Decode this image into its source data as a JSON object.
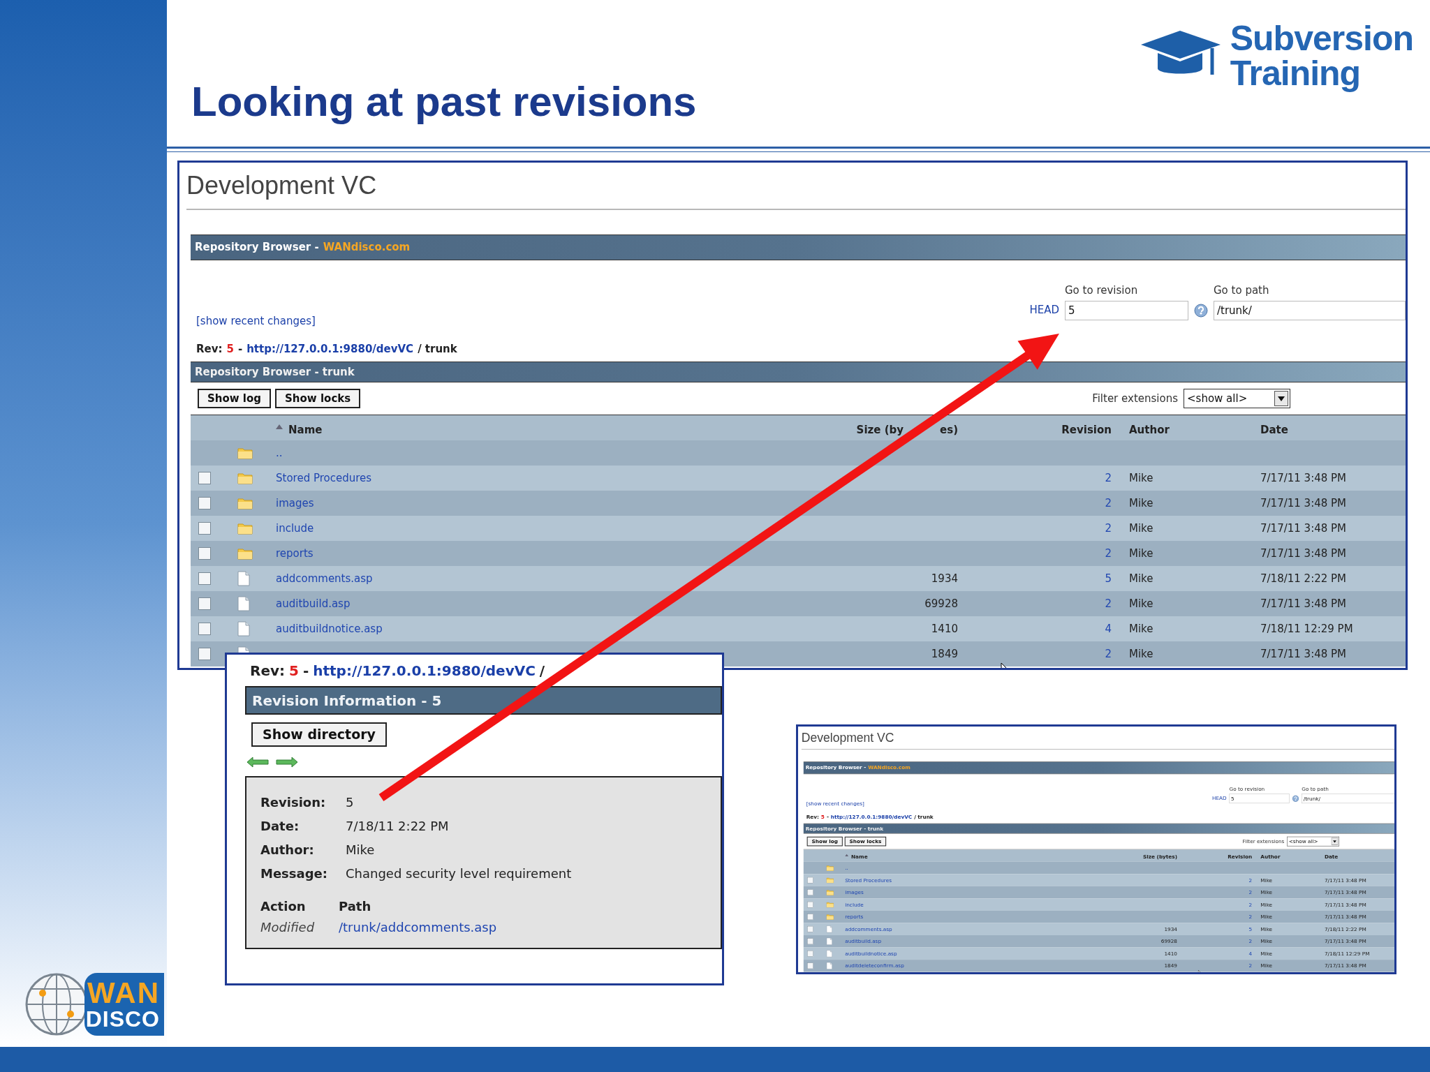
{
  "slide": {
    "title": "Looking at past revisions",
    "brand_logo": [
      "Subversion",
      "Training"
    ],
    "footer_logo": [
      "WAN",
      "DISCO"
    ]
  },
  "main_screenshot": {
    "page_title": "Development VC",
    "header_bar": {
      "label": "Repository Browser -",
      "link": "WANdisco.com"
    },
    "revision_label": "Go to revision",
    "path_label": "Go to path",
    "head_link": "HEAD",
    "revision_field": "5",
    "path_field": "/trunk/",
    "recent_changes_link": "[show recent changes]",
    "rev_line": {
      "prefix": "Rev:",
      "revision": "5",
      "dash": "-",
      "url": "http://127.0.0.1:9880/devVC",
      "path": "/ trunk"
    },
    "section_bar": "Repository Browser - trunk",
    "buttons": [
      "Show log",
      "Show locks"
    ],
    "filter_label": "Filter extensions",
    "filter_value": "<show all>",
    "columns": [
      {
        "label": "Name",
        "sorted": true
      },
      {
        "label": "Size (by",
        "label_after": "es)",
        "sorted": false
      },
      {
        "label": "Revision",
        "sorted": false
      },
      {
        "label": "Author",
        "sorted": false
      },
      {
        "label": "Date",
        "sorted": false
      }
    ],
    "rows": [
      {
        "kind": "parent",
        "name": ".."
      },
      {
        "kind": "folder",
        "name": "Stored Procedures",
        "revision": "2",
        "author": "Mike",
        "date": "7/17/11 3:48 PM",
        "checked": false
      },
      {
        "kind": "folder",
        "name": "images",
        "revision": "2",
        "author": "Mike",
        "date": "7/17/11 3:48 PM",
        "checked": false
      },
      {
        "kind": "folder",
        "name": "include",
        "revision": "2",
        "author": "Mike",
        "date": "7/17/11 3:48 PM",
        "checked": false
      },
      {
        "kind": "folder",
        "name": "reports",
        "revision": "2",
        "author": "Mike",
        "date": "7/17/11 3:48 PM",
        "checked": false
      },
      {
        "kind": "file",
        "name": "addcomments.asp",
        "size": "1934",
        "revision": "5",
        "author": "Mike",
        "date": "7/18/11 2:22 PM",
        "checked": false
      },
      {
        "kind": "file",
        "name": "auditbuild.asp",
        "size": "69928",
        "revision": "2",
        "author": "Mike",
        "date": "7/17/11 3:48 PM",
        "checked": false
      },
      {
        "kind": "file",
        "name": "auditbuildnotice.asp",
        "size": "1410",
        "revision": "4",
        "author": "Mike",
        "date": "7/18/11 12:29 PM",
        "checked": false
      },
      {
        "kind": "file",
        "size": "1849",
        "revision": "2",
        "author": "Mike",
        "date": "7/17/11 3:48 PM",
        "checked": false
      }
    ]
  },
  "revision_popup": {
    "rev_line": {
      "prefix": "Rev:",
      "revision": "5",
      "dash": "-",
      "url": "http://127.0.0.1:9880/devVC",
      "path": "/"
    },
    "title_bar": "Revision Information - 5",
    "button": "Show directory",
    "details": [
      {
        "label": "Revision:",
        "value": "5"
      },
      {
        "label": "Date:",
        "value": "7/18/11 2:22 PM"
      },
      {
        "label": "Author:",
        "value": "Mike"
      },
      {
        "label": "Message:",
        "value": "Changed security level requirement"
      }
    ],
    "change_columns": [
      "Action",
      "Path"
    ],
    "changes": [
      {
        "action": "Modified",
        "path": "/trunk/addcomments.asp"
      }
    ]
  },
  "inset_screenshot": {
    "page_title": "Development VC",
    "header_bar": {
      "label": "Repository Browser -",
      "link": "WANdisco.com"
    },
    "revision_label": "Go to revision",
    "path_label": "Go to path",
    "head_link": "HEAD",
    "revision_field": "5",
    "path_field": "/trunk/",
    "recent_changes_link": "[show recent changes]",
    "rev_line": {
      "prefix": "Rev:",
      "revision": "5",
      "dash": "-",
      "url": "http://127.0.0.1:9880/devVC",
      "path": "/ trunk"
    },
    "section_bar": "Repository Browser - trunk",
    "buttons": [
      "Show log",
      "Show locks"
    ],
    "filter_label": "Filter extensions",
    "filter_value": "<show all>",
    "columns": [
      {
        "label": "Name",
        "sorted": true
      },
      {
        "label": "Size (bytes)",
        "sorted": false
      },
      {
        "label": "Revision",
        "sorted": false
      },
      {
        "label": "Author",
        "sorted": false
      },
      {
        "label": "Date",
        "sorted": false
      }
    ],
    "rows": [
      {
        "kind": "parent",
        "name": ".."
      },
      {
        "kind": "folder",
        "name": "Stored Procedures",
        "revision": "2",
        "author": "Mike",
        "date": "7/17/11 3:48 PM",
        "checked": false
      },
      {
        "kind": "folder",
        "name": "images",
        "revision": "2",
        "author": "Mike",
        "date": "7/17/11 3:48 PM",
        "checked": false
      },
      {
        "kind": "folder",
        "name": "include",
        "revision": "2",
        "author": "Mike",
        "date": "7/17/11 3:48 PM",
        "checked": false
      },
      {
        "kind": "folder",
        "name": "reports",
        "revision": "2",
        "author": "Mike",
        "date": "7/17/11 3:48 PM",
        "checked": false
      },
      {
        "kind": "file",
        "name": "addcomments.asp",
        "size": "1934",
        "revision": "5",
        "author": "Mike",
        "date": "7/18/11 2:22 PM",
        "checked": false
      },
      {
        "kind": "file",
        "name": "auditbuild.asp",
        "size": "69928",
        "revision": "2",
        "author": "Mike",
        "date": "7/17/11 3:48 PM",
        "checked": false
      },
      {
        "kind": "file",
        "name": "auditbuildnotice.asp",
        "size": "1410",
        "revision": "4",
        "author": "Mike",
        "date": "7/18/11 12:29 PM",
        "checked": false
      },
      {
        "kind": "file",
        "name": "auditdeleteconfirm.asp",
        "size": "1849",
        "revision": "2",
        "author": "Mike",
        "date": "7/17/11 3:48 PM",
        "checked": false
      }
    ]
  }
}
